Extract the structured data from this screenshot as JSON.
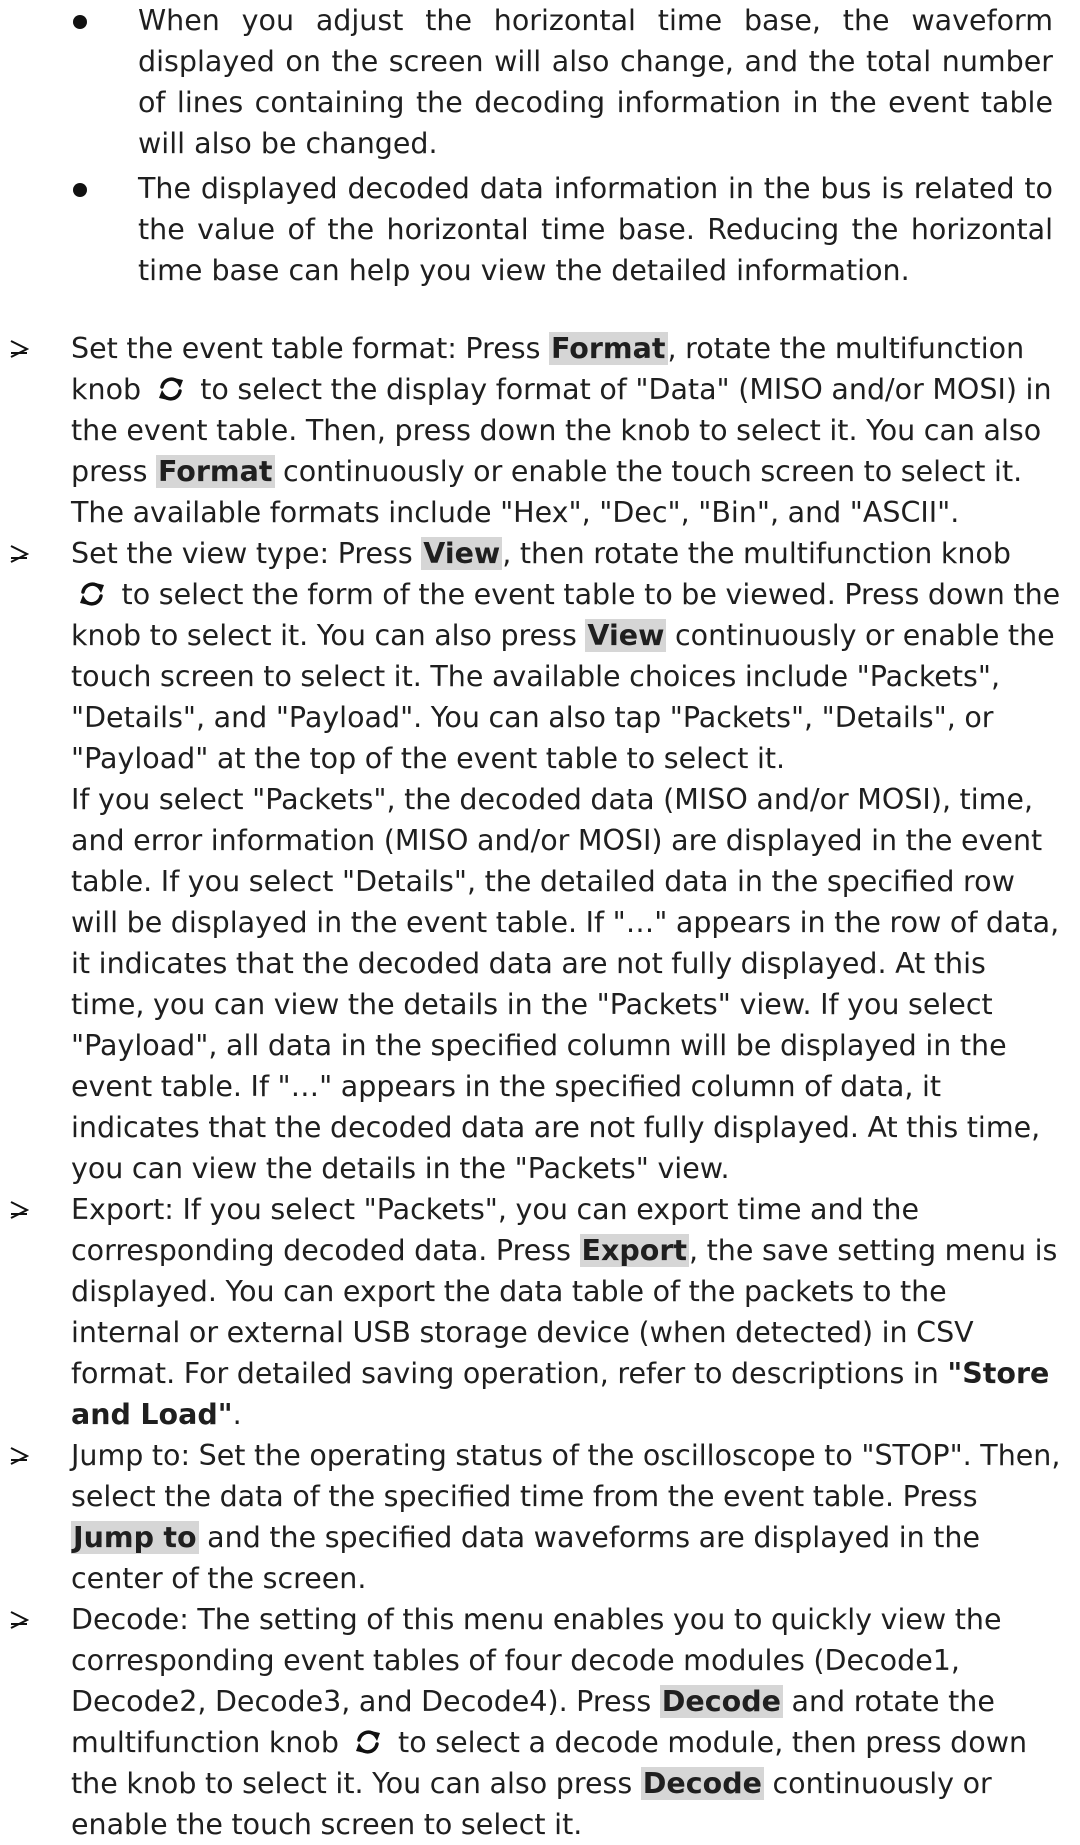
{
  "notes": [
    "When you adjust the horizontal time base, the waveform displayed on the screen will also change, and the total number of lines containing the decoding information in the event table will also be changed.",
    "The displayed decoded data information in the bus is related to the value of the horizontal time base. Reducing the horizontal time base can help you view the detailed information."
  ],
  "format_step": {
    "t1": "Set the event table format: Press ",
    "k1": "Format",
    "t2": ", rotate the multifunction knob ",
    "knob_icon": "rotate-knob-icon",
    "t3": " to select the display format of \"Data\" (MISO and/or MOSI) in the event table. Then, press down the knob to select it. You can also press ",
    "k2": "Format",
    "t4": " continuously or enable the touch screen to select it. The available formats include \"Hex\", \"Dec\", \"Bin\", and \"ASCII\"."
  },
  "view_step": {
    "t1": "Set the view type: Press ",
    "k1": "View",
    "t2": ", then rotate the multifunction knob ",
    "knob_icon": "rotate-knob-icon",
    "t3": " to select the form of the event table to be viewed. Press down the knob to select it. You can also press ",
    "k2": "View",
    "t4": " continuously or enable the touch screen to select it. The available choices include \"Packets\", \"Details\", and \"Payload\". You can also tap \"Packets\", \"Details\", or \"Payload\" at the top of the event table to select it.",
    "para2": "If you select \"Packets\", the decoded data (MISO and/or MOSI), time, and error information (MISO and/or MOSI) are displayed in the event table. If you select \"Details\", the detailed data in the specified row will be displayed in the event table. If \"…\" appears in the row of data, it indicates that the decoded data are not fully displayed. At this time, you can view the details in the \"Packets\" view. If you select \"Payload\", all data in the specified column will be displayed in the event table. If \"…\" appears in the specified column of data, it indicates that the decoded data are not fully displayed. At this time, you can view the details in the \"Packets\" view."
  },
  "export_step": {
    "t1": "Export: If you select \"Packets\", you can export time and the corresponding decoded data. Press ",
    "k1": "Export",
    "t2": ", the save setting menu is displayed. You can export the data table of the packets to the internal or external USB storage device (when detected) in CSV format. For detailed saving operation, refer to descriptions in ",
    "ref": "\"Store and Load\"",
    "t3": "."
  },
  "jump_step": {
    "t1": "Jump to: Set the operating status of the oscilloscope to \"STOP\". Then, select the data of the specified time from the event table. Press ",
    "k1": "Jump to",
    "t2": " and the specified data waveforms are displayed in the center of the screen."
  },
  "decode_step": {
    "t1": "Decode: The setting of this menu enables you to quickly view the corresponding event tables of four decode modules (Decode1, Decode2, Decode3, and Decode4). Press ",
    "k1": "Decode",
    "t2": " and rotate the multifunction knob ",
    "knob_icon": "rotate-knob-icon",
    "t3": " to select a decode module, then press down the knob to select it. You can also press ",
    "k2": "Decode",
    "t4": " continuously or enable the touch screen to select it."
  }
}
